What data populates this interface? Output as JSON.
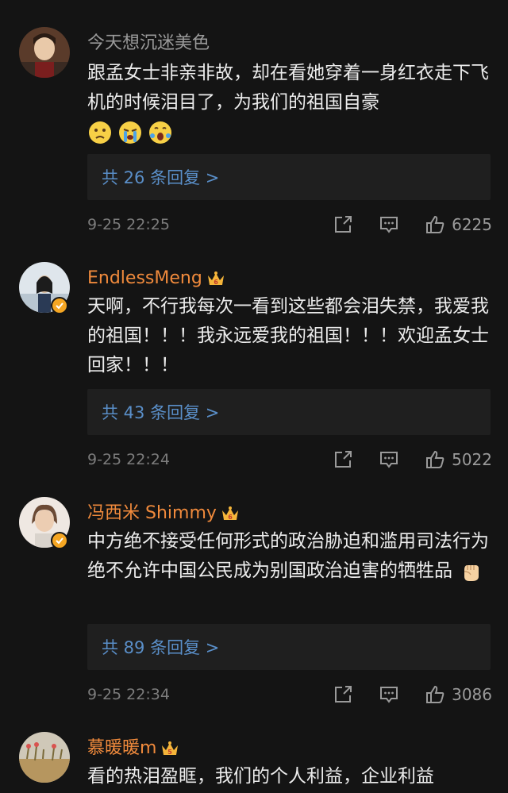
{
  "comments": [
    {
      "username": "今天想沉迷美色",
      "body": "跟孟女士非亲非故，却在看她穿着一身红衣走下飞机的时候泪目了，为我们的祖国自豪",
      "emojis": [
        "sad-face-icon",
        "crying-face-icon",
        "surprised-tears-face-icon"
      ],
      "replies": "共 26 条回复 >",
      "time": "9-25 22:25",
      "likes": "6225"
    },
    {
      "username": "EndlessMeng",
      "body": "天啊，不行我每次一看到这些都会泪失禁，我爱我的祖国！！！我永远爱我的祖国！！！欢迎孟女士回家！！！",
      "replies": "共 43 条回复 >",
      "time": "9-25 22:24",
      "likes": "5022"
    },
    {
      "username": "冯西米 Shimmy",
      "body": "中方绝不接受任何形式的政治胁迫和滥用司法行为 绝不允许中国公民成为别国政治迫害的牺牲品",
      "emojis": [
        "raised-fist-icon"
      ],
      "replies": "共 89 条回复 >",
      "time": "9-25 22:34",
      "likes": "3086"
    },
    {
      "username": "慕暖暖m",
      "body": "看的热泪盈眶，我们的个人利益，企业利益"
    }
  ],
  "colors": {
    "background": "#141414",
    "vip_name": "#f08a3c",
    "reply_link": "#5a8fc9",
    "verified_badge": "#f5a623"
  }
}
